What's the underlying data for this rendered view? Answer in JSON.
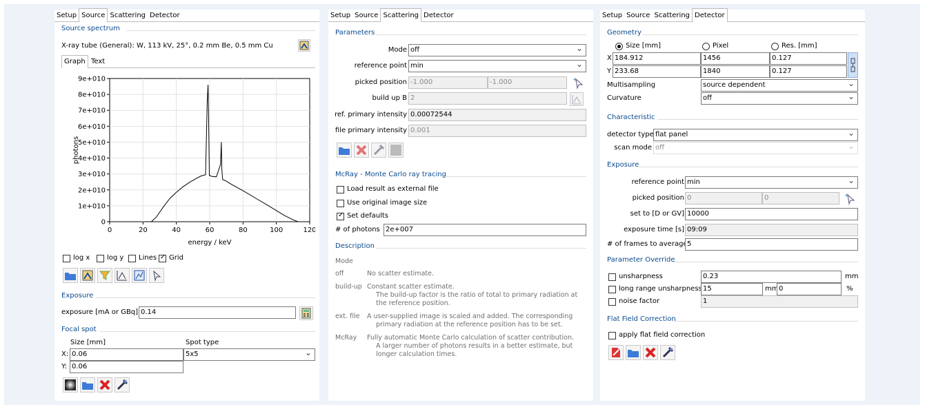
{
  "tabs_main": [
    "Setup",
    "Source",
    "Scattering",
    "Detector"
  ],
  "source": {
    "section_spectrum": "Source spectrum",
    "tube": "X-ray tube (General): W, 113 kV, 25°, 0.2 mm Be, 0.5 mm Cu",
    "subtabs": [
      "Graph",
      "Text"
    ],
    "options": {
      "logx": "log x",
      "logy": "log y",
      "lines": "Lines",
      "grid": "Grid"
    },
    "section_exposure": "Exposure",
    "exposure_label": "exposure [mA or GBq]",
    "exposure_value": "0.14",
    "section_focal": "Focal spot",
    "size_label": "Size [mm]",
    "spot_label": "Spot type",
    "x_label": "X:",
    "x_value": "0.06",
    "y_label": "Y:",
    "y_value": "0.06",
    "spot_value": "5x5"
  },
  "chart_data": {
    "type": "line",
    "xlabel": "energy / keV",
    "ylabel": "photons",
    "xlim": [
      0,
      120
    ],
    "ylim": [
      0,
      90000000000.0
    ],
    "xticks": [
      "0",
      "20",
      "40",
      "60",
      "80",
      "100",
      "120"
    ],
    "yticks": [
      "0",
      "1e+010",
      "2e+010",
      "3e+010",
      "4e+010",
      "5e+010",
      "6e+010",
      "7e+010",
      "8e+010",
      "9e+010"
    ],
    "grid": true,
    "x": [
      25,
      28,
      32,
      36,
      40,
      44,
      48,
      52,
      55,
      57.5,
      58.5,
      59,
      59.3,
      59.8,
      60.5,
      61,
      64,
      66.5,
      67,
      67.3,
      67.8,
      68.5,
      69.5,
      73,
      80,
      88,
      95,
      100,
      105,
      110,
      113
    ],
    "y": [
      0,
      3000000000.0,
      9000000000.0,
      14500000000.0,
      18500000000.0,
      22000000000.0,
      24800000000.0,
      27200000000.0,
      28800000000.0,
      29500000000.0,
      75000000000.0,
      86000000000.0,
      70000000000.0,
      29000000000.0,
      29000000000.0,
      28500000000.0,
      28200000000.0,
      36000000000.0,
      50000000000.0,
      33000000000.0,
      26500000000.0,
      26200000000.0,
      25800000000.0,
      23500000000.0,
      19500000000.0,
      14500000000.0,
      10200000000.0,
      7000000000.0,
      3800000000.0,
      1200000000.0,
      0
    ]
  },
  "scattering": {
    "section_params": "Parameters",
    "mode_label": "Mode",
    "mode_value": "off",
    "refpt_label": "reference point",
    "refpt_value": "min",
    "picked_label": "picked position",
    "picked_x": "-1.000",
    "picked_y": "-1.000",
    "buildup_label": "build up B",
    "buildup_value": "2",
    "refint_label": "ref. primary intensity",
    "refint_value": "0.00072544",
    "fileint_label": "file primary intensity",
    "fileint_value": "0.001",
    "section_mcray": "McRay - Monte Carlo ray tracing",
    "load_label": "Load result as external file",
    "orig_label": "Use original image size",
    "defaults_label": "Set defaults",
    "photons_label": "# of photons",
    "photons_value": "2e+007",
    "section_desc": "Description",
    "desc_mode": "Mode",
    "desc": [
      {
        "k": "off",
        "v": "No scatter estimate."
      },
      {
        "k": "build-up",
        "v": "Constant scatter estimate.",
        "v2": "The build-up factor is the ratio of total to primary radiation at",
        "v3": "the reference position."
      },
      {
        "k": "ext. file",
        "v": "A user-supplied image is scaled and added. The corresponding",
        "v2": "primary radiation at the reference position has to be set."
      },
      {
        "k": "McRay",
        "v": "Fully automatic Monte Carlo calculation of scatter contribution.",
        "v2": "A larger number of photons results in a better estimate, but",
        "v3": "longer calculation times."
      }
    ]
  },
  "detector": {
    "section_geom": "Geometry",
    "col_size": "Size [mm]",
    "col_pixel": "Pixel",
    "col_res": "Res. [mm]",
    "x_label": "X",
    "x_size": "184.912",
    "x_pixel": "1456",
    "x_res": "0.127",
    "y_label": "Y",
    "y_size": "233.68",
    "y_pixel": "1840",
    "y_res": "0.127",
    "multisampling_label": "Multisampling",
    "multisampling_value": "source dependent",
    "curvature_label": "Curvature",
    "curvature_value": "off",
    "section_char": "Characteristic",
    "dettype_label": "detector type",
    "dettype_value": "flat panel",
    "scanmode_label": "scan mode",
    "scanmode_value": "off",
    "section_exposure": "Exposure",
    "refpt_label": "reference point",
    "refpt_value": "min",
    "picked_label": "picked position",
    "picked_x": "0",
    "picked_y": "0",
    "setto_label": "set to [D or GV]",
    "setto_value": "10000",
    "exptime_label": "exposure time [s]",
    "exptime_value": "09:09",
    "frames_label": "# of frames to average",
    "frames_value": "5",
    "section_override": "Parameter Override",
    "unsharp_label": "unsharpness",
    "unsharp_value": "0.23",
    "unsharp_unit": "mm",
    "longrange_label": "long range unsharpness",
    "longrange_value": "15",
    "longrange_unit": "mm",
    "longrange_value2": "0",
    "longrange_unit2": "%",
    "noise_label": "noise factor",
    "noise_value": "1",
    "section_ff": "Flat Field Correction",
    "ff_label": "apply flat field correction"
  }
}
